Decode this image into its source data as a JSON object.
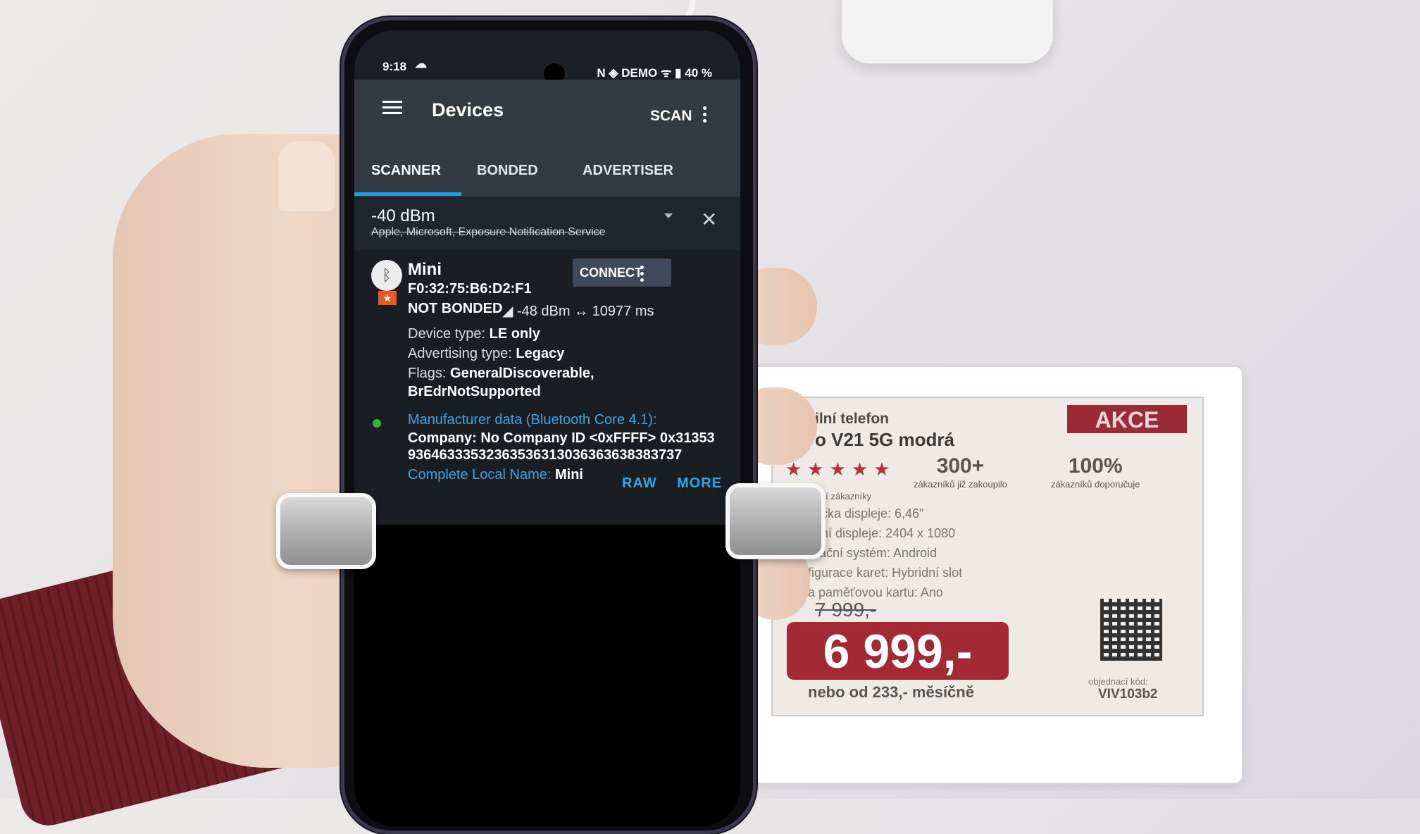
{
  "status_bar": {
    "time": "9:18",
    "right": "N ◈ DEMO ᯤ ▮ 40 %"
  },
  "app_bar": {
    "title": "Devices",
    "scan_label": "SCAN"
  },
  "tabs": [
    {
      "label": "SCANNER"
    },
    {
      "label": "BONDED"
    },
    {
      "label": "ADVERTISER"
    }
  ],
  "filter": {
    "rssi": "-40 dBm",
    "services": "Apple, Microsoft, Exposure Notification Service"
  },
  "device": {
    "name": "Mini",
    "address": "F0:32:75:B6:D2:F1",
    "bond_state": "NOT BONDED",
    "rssi": "◢ -48 dBm",
    "interval": "↔ 10977 ms",
    "connect_label": "CONNECT",
    "device_type_label": "Device type:",
    "device_type": "LE only",
    "adv_type_label": "Advertising type:",
    "adv_type": "Legacy",
    "flags_label": "Flags:",
    "flags_1": "GeneralDiscoverable,",
    "flags_2": "BrEdrNotSupported",
    "mfr_header": "Manufacturer data (Bluetooth Core 4.1):",
    "mfr_company": "Company: No Company ID <0xFFFF> 0x31353",
    "mfr_data": "9364633353236353631303636363838373​7",
    "local_name_label": "Complete Local Name:",
    "local_name": "Mini",
    "raw_label": "RAW",
    "more_label": "MORE"
  },
  "price_tag": {
    "title": "ilní telefon",
    "subtitle": "o V21 5G modrá",
    "akce": "AKCE",
    "rating_caption": "hodnocení zákazníky",
    "stat1_value": "300+",
    "stat1_caption": "zákazníků již zakoupilo",
    "stat2_value": "100%",
    "stat2_caption": "zákazníků doporučuje",
    "spec_1": "ypřička displeje: 6,46\"",
    "spec_2": "ešení displeje: 2404 x 1080",
    "spec_3": "perační systém: Android",
    "spec_4": "nfigurace karet: Hybridní slot",
    "spec_5": "na paměťovou kartu: Ano",
    "old_price": "7 999,-",
    "price": "6 999,-",
    "monthly": "nebo od 233,- měsíčně",
    "code_label": "objednací kód:",
    "code": "VIV103b2"
  },
  "colors": {
    "accent": "#1f9fe0",
    "app_bar": "#333a41",
    "price_red": "#a32a35"
  }
}
